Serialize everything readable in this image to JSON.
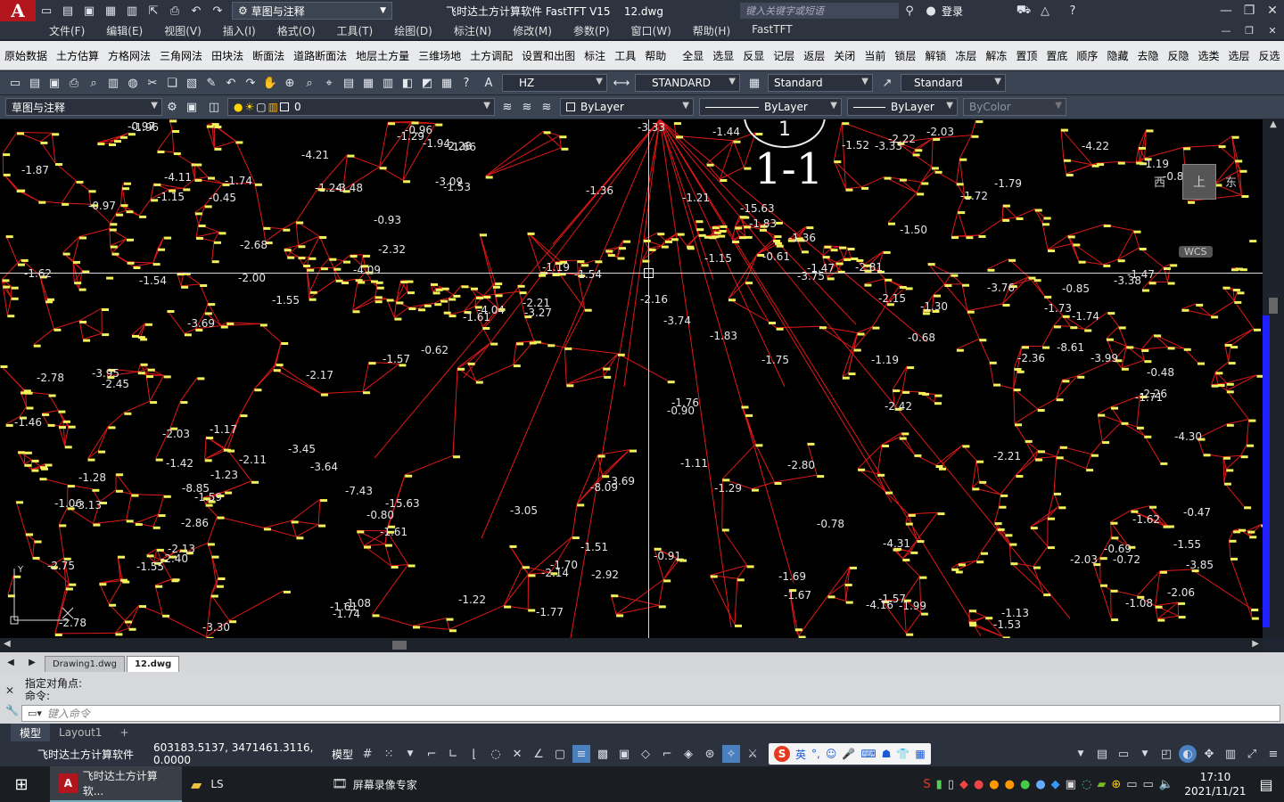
{
  "title": {
    "app_logo": "A",
    "workspace": "草图与注释",
    "text": "飞时达土方计算软件 FastTFT V15    12.dwg",
    "search_placeholder": "键入关键字或短语",
    "login": "登录"
  },
  "menu": [
    "文件(F)",
    "编辑(E)",
    "视图(V)",
    "插入(I)",
    "格式(O)",
    "工具(T)",
    "绘图(D)",
    "标注(N)",
    "修改(M)",
    "参数(P)",
    "窗口(W)",
    "帮助(H)",
    "FastTFT"
  ],
  "fastbar_left": [
    "原始数据",
    "土方估算",
    "方格网法",
    "三角网法",
    "田块法",
    "断面法",
    "道路断面法",
    "地层土方量",
    "三维场地",
    "土方调配",
    "设置和出图",
    "标注",
    "工具",
    "帮助"
  ],
  "fastbar_right": [
    "全显",
    "选显",
    "反显",
    "记层",
    "返层",
    "关闭",
    "当前",
    "锁层",
    "解锁",
    "冻层",
    "解冻",
    "置顶",
    "置底",
    "顺序",
    "隐藏",
    "去隐",
    "反隐",
    "选类",
    "选层",
    "反选"
  ],
  "toolbar1": {
    "text_style": "HZ",
    "dim_style": "STANDARD",
    "table_style": "Standard",
    "mleader_style": "Standard"
  },
  "toolbar2": {
    "workspace": "草图与注释",
    "layer": "0",
    "color": "ByLayer",
    "linetype": "ByLayer",
    "lineweight": "ByLayer",
    "plotstyle": "ByColor"
  },
  "drawing": {
    "section_label": "1-1",
    "section_marker": "1",
    "viewcube_west": "西",
    "viewcube_top": "上",
    "viewcube_east": "东",
    "viewcube_wcs": "WCS",
    "labels": [
      "-0.85",
      "-1.96",
      "-3.38",
      "-3.85",
      "-1.61",
      "-1.59",
      "-3.27",
      "-15.63",
      "-4.11",
      "-4.21",
      "-2.13",
      "-0.68",
      "-1.53",
      "-1.74",
      "-1.42",
      "-1.55",
      "-2.32",
      "-1.30",
      "-1.06",
      "-4.22",
      "-1.15",
      "-3.74",
      "-3.99",
      "-1.44",
      "-1.70",
      "-1.19",
      "-0.45",
      "-1.15",
      "-1.74",
      "-1.52",
      "-1.23",
      "-1.69",
      "-2.03",
      "-1.53",
      "-3.05",
      "-4.16",
      "-3.75",
      "-4.09",
      "-8.61",
      "-3.30",
      "-1.75",
      "-1.57",
      "-2.21",
      "-2.80",
      "-1.47",
      "-1.24",
      "-1.13",
      "-1.99",
      "-0.62",
      "-1.29",
      "-1.62",
      "-1.28",
      "-1.17",
      "-2.06",
      "-1.36",
      "-1.19",
      "-3.13",
      "-2.68",
      "-2.86",
      "-1.79",
      "-1.36",
      "-1.73",
      "-1.77",
      "-1.72",
      "-1.19",
      "-1.51",
      "-1.74",
      "-1.61",
      "-0.96",
      "-2.03",
      "-2.15",
      "-0.97",
      "-0.69",
      "-3.33",
      "-2.21",
      "-2.75",
      "-2.78",
      "-4.04",
      "-3.69",
      "-4.31",
      "-1.67",
      "-2.11",
      "-2.42",
      "-2.26",
      "-1.47",
      "-1.55",
      "-0.86",
      "-2.17",
      "-1.61",
      "-3.69",
      "-3.48",
      "-3.76",
      "-4.30",
      "-8.85",
      "-2.81",
      "-1.71",
      "-1.08",
      "-1.94",
      "-0.78",
      "-1.21",
      "-1.54",
      "-3.33",
      "-2.14",
      "-2.40",
      "-1.83",
      "-1.57",
      "-1.11",
      "-1.66",
      "-0.48",
      "-3.09",
      "-3.64",
      "-0.90",
      "-2.03",
      "-2.78",
      "-2.22",
      "-2.28",
      "-8.09",
      "-15.63",
      "-2.16",
      "-0.97",
      "-2.92",
      "-3.45",
      "-7.43",
      "-2.36",
      "-1.76",
      "-0.93",
      "-2.45",
      "-1.55",
      "-3.95",
      "-1.46",
      "-1.83",
      "-1.62",
      "-1.54",
      "-0.80",
      "-1.08",
      "-2.00",
      "-1.50",
      "-1.22",
      "-1.29",
      "-0.47",
      "-0.61",
      "-0.72",
      "-1.87",
      "-0.91"
    ]
  },
  "file_tabs": [
    "Drawing1.dwg",
    "12.dwg"
  ],
  "command": {
    "history1": "指定对角点:",
    "history2": "命令:",
    "placeholder": "键入命令"
  },
  "layout_tabs": [
    "模型",
    "Layout1",
    "+"
  ],
  "status": {
    "app_name": "飞时达土方计算软件",
    "coords": "603183.5137, 3471461.3116, 0.0000",
    "mode": "模型",
    "ime": "英"
  },
  "taskbar": {
    "apps": [
      "飞时达土方计算软...",
      "LS",
      "屏幕录像专家"
    ],
    "time": "17:10",
    "date": "2021/11/21"
  },
  "colors": {
    "accent": "#b3151c",
    "mesh": "#e01818",
    "label": "#e8e8e8",
    "point_label": "#f2f25a",
    "background": "#000000"
  }
}
